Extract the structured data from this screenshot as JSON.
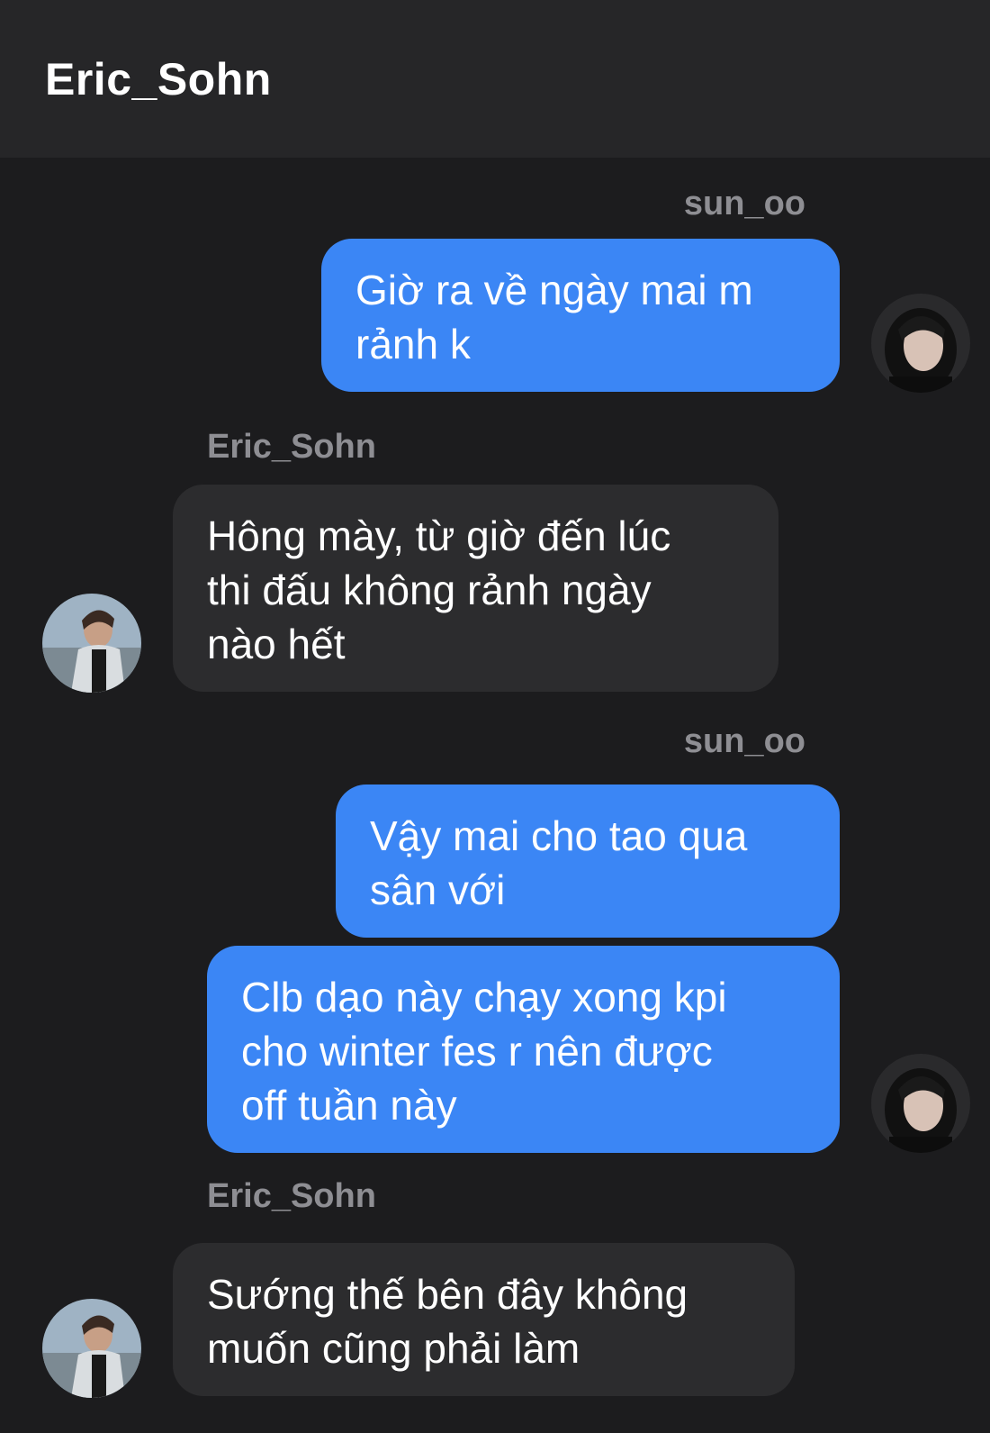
{
  "header": {
    "title": "Eric_Sohn"
  },
  "messages": [
    {
      "sender": "sun_oo",
      "text": "Giờ ra về ngày mai m\nrảnh k"
    },
    {
      "sender": "Eric_Sohn",
      "text": "Hông mày, từ giờ đến lúc\nthi đấu không rảnh ngày\nnào hết"
    },
    {
      "sender": "sun_oo",
      "text": "Vậy mai cho tao qua\nsân với"
    },
    {
      "text": "Clb dạo này chạy xong kpi\ncho winter fes r nên được\noff tuần này"
    },
    {
      "sender": "Eric_Sohn",
      "text": "Sướng thế bên đây không\nmuốn cũng phải làm"
    }
  ],
  "colors": {
    "background": "#1c1c1e",
    "header": "#262628",
    "outgoing_bubble": "#3b86f5",
    "incoming_bubble": "#2c2c2e",
    "sender_label": "#8e8e93"
  }
}
